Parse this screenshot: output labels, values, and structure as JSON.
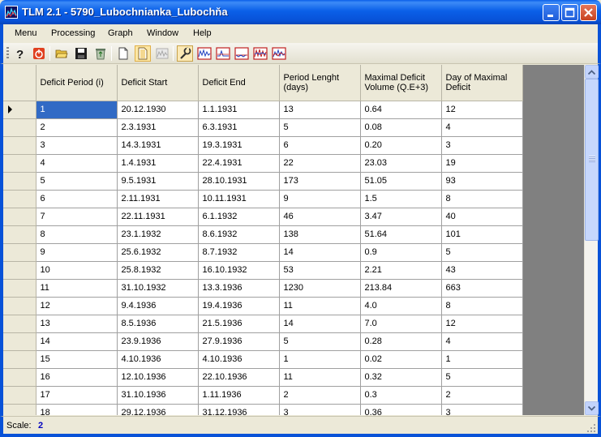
{
  "window": {
    "title": "TLM 2.1 - 5790_Lubochnianka_Lubochňa",
    "icon": "tlm-app-icon",
    "controls": [
      "minimize-icon",
      "maximize-icon",
      "close-icon"
    ]
  },
  "menu": {
    "items": [
      "Menu",
      "Processing",
      "Graph",
      "Window",
      "Help"
    ]
  },
  "toolbar": {
    "buttons": [
      {
        "icon": "help-icon"
      },
      {
        "icon": "power-icon"
      },
      {
        "icon": "open-folder-icon"
      },
      {
        "icon": "save-icon"
      },
      {
        "icon": "recycle-icon"
      },
      {
        "icon": "new-document-icon"
      },
      {
        "icon": "document-icon"
      },
      {
        "icon": "graph-disabled-icon"
      },
      {
        "icon": "wrench-icon"
      },
      {
        "icon": "hydrograph-icon"
      },
      {
        "icon": "threshold-graph-icon"
      },
      {
        "icon": "deficit-graph-icon"
      },
      {
        "icon": "multi-graph-icon"
      },
      {
        "icon": "compare-graph-icon"
      }
    ]
  },
  "grid": {
    "columns": [
      "Deficit Period (i)",
      "Deficit Start",
      "Deficit End",
      "Period Lenght (days)",
      "Maximal Deficit Volume (Q.E+3)",
      "Day of Maximal Deficit"
    ],
    "rows": [
      [
        "1",
        "20.12.1930",
        "1.1.1931",
        "13",
        "0.64",
        "12"
      ],
      [
        "2",
        "2.3.1931",
        "6.3.1931",
        "5",
        "0.08",
        "4"
      ],
      [
        "3",
        "14.3.1931",
        "19.3.1931",
        "6",
        "0.20",
        "3"
      ],
      [
        "4",
        "1.4.1931",
        "22.4.1931",
        "22",
        "23.03",
        "19"
      ],
      [
        "5",
        "9.5.1931",
        "28.10.1931",
        "173",
        "51.05",
        "93"
      ],
      [
        "6",
        "2.11.1931",
        "10.11.1931",
        "9",
        "1.5",
        "8"
      ],
      [
        "7",
        "22.11.1931",
        "6.1.1932",
        "46",
        "3.47",
        "40"
      ],
      [
        "8",
        "23.1.1932",
        "8.6.1932",
        "138",
        "51.64",
        "101"
      ],
      [
        "9",
        "25.6.1932",
        "8.7.1932",
        "14",
        "0.9",
        "5"
      ],
      [
        "10",
        "25.8.1932",
        "16.10.1932",
        "53",
        "2.21",
        "43"
      ],
      [
        "11",
        "31.10.1932",
        "13.3.1936",
        "1230",
        "213.84",
        "663"
      ],
      [
        "12",
        "9.4.1936",
        "19.4.1936",
        "11",
        "4.0",
        "8"
      ],
      [
        "13",
        "8.5.1936",
        "21.5.1936",
        "14",
        "7.0",
        "12"
      ],
      [
        "14",
        "23.9.1936",
        "27.9.1936",
        "5",
        "0.28",
        "4"
      ],
      [
        "15",
        "4.10.1936",
        "4.10.1936",
        "1",
        "0.02",
        "1"
      ],
      [
        "16",
        "12.10.1936",
        "22.10.1936",
        "11",
        "0.32",
        "5"
      ],
      [
        "17",
        "31.10.1936",
        "1.11.1936",
        "2",
        "0.3",
        "2"
      ],
      [
        "18",
        "29.12.1936",
        "31.12.1936",
        "3",
        "0.36",
        "3"
      ]
    ]
  },
  "statusbar": {
    "label": "Scale:",
    "value": "2"
  },
  "colors": {
    "titlebar": "#0A5FE8",
    "selection": "#316AC5",
    "status_value": "#0000C0"
  }
}
